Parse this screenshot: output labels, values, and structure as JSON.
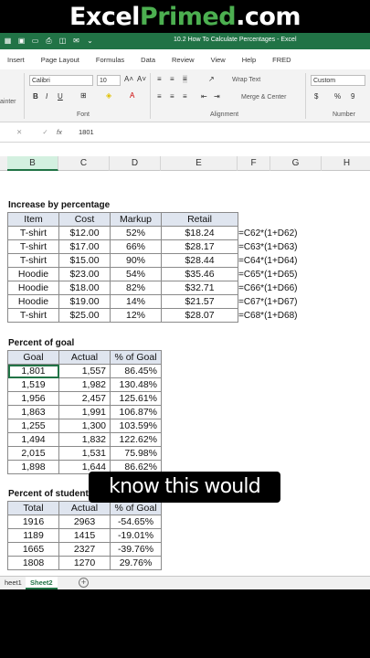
{
  "banner": {
    "part1": "Excel",
    "part2": "Primed",
    "part3": ".com"
  },
  "titlebar": {
    "title": "10.2 How To Calculate Percentages  -  Excel",
    "icons": [
      "excel-logo-icon",
      "save-icon",
      "folder-icon",
      "print-icon",
      "preview-icon",
      "email-icon",
      "chevron-icon"
    ]
  },
  "ribbon_tabs": [
    "Insert",
    "Page Layout",
    "Formulas",
    "Data",
    "Review",
    "View",
    "Help",
    "FRED"
  ],
  "ribbon": {
    "font_name": "Calibri",
    "font_size": "10",
    "wrap_text": "Wrap Text",
    "merge_center": "Merge & Center",
    "number_format": "Custom",
    "painter_label": "ainter",
    "group_font": "Font",
    "group_alignment": "Alignment",
    "group_number": "Number",
    "bold": "B",
    "italic": "I",
    "underline": "U",
    "grow_font": "A˄",
    "shrink_font": "A˅",
    "currency": "$",
    "percent": "%",
    "comma": "9"
  },
  "formula_bar": {
    "fx": "fx",
    "value": "1801"
  },
  "columns": [
    "B",
    "C",
    "D",
    "E",
    "F",
    "G",
    "H"
  ],
  "active_column": "B",
  "section1": {
    "title": "Increase by percentage",
    "headers": [
      "Item",
      "Cost",
      "Markup",
      "Retail"
    ],
    "rows": [
      [
        "T-shirt",
        "$12.00",
        "52%",
        "$18.24",
        "=C62*(1+D62)"
      ],
      [
        "T-shirt",
        "$17.00",
        "66%",
        "$28.17",
        "=C63*(1+D63)"
      ],
      [
        "T-shirt",
        "$15.00",
        "90%",
        "$28.44",
        "=C64*(1+D64)"
      ],
      [
        "Hoodie",
        "$23.00",
        "54%",
        "$35.46",
        "=C65*(1+D65)"
      ],
      [
        "Hoodie",
        "$18.00",
        "82%",
        "$32.71",
        "=C66*(1+D66)"
      ],
      [
        "Hoodie",
        "$19.00",
        "14%",
        "$21.57",
        "=C67*(1+D67)"
      ],
      [
        "T-shirt",
        "$25.00",
        "12%",
        "$28.07",
        "=C68*(1+D68)"
      ]
    ]
  },
  "section2": {
    "title": "Percent of goal",
    "headers": [
      "Goal",
      "Actual",
      "% of Goal"
    ],
    "rows": [
      [
        "1,801",
        "1,557",
        "86.45%"
      ],
      [
        "1,519",
        "1,982",
        "130.48%"
      ],
      [
        "1,956",
        "2,457",
        "125.61%"
      ],
      [
        "1,863",
        "1,991",
        "106.87%"
      ],
      [
        "1,255",
        "1,300",
        "103.59%"
      ],
      [
        "1,494",
        "1,832",
        "122.62%"
      ],
      [
        "2,015",
        "1,531",
        "75.98%"
      ],
      [
        "1,898",
        "1,644",
        "86.62%"
      ]
    ]
  },
  "section3": {
    "title": "Percent of student",
    "headers": [
      "Total",
      "Actual",
      "% of Goal"
    ],
    "rows": [
      [
        "1916",
        "2963",
        "-54.65%"
      ],
      [
        "1189",
        "1415",
        "-19.01%"
      ],
      [
        "1665",
        "2327",
        "-39.76%"
      ],
      [
        "1808",
        "1270",
        "29.76%"
      ]
    ]
  },
  "caption": "know this would",
  "sheet_tabs": [
    "heet1",
    "Sheet2"
  ],
  "active_sheet": "Sheet2",
  "colors": {
    "excel_green": "#217346",
    "accent_green": "#4CAF50",
    "header_fill": "#dfe5ef"
  }
}
